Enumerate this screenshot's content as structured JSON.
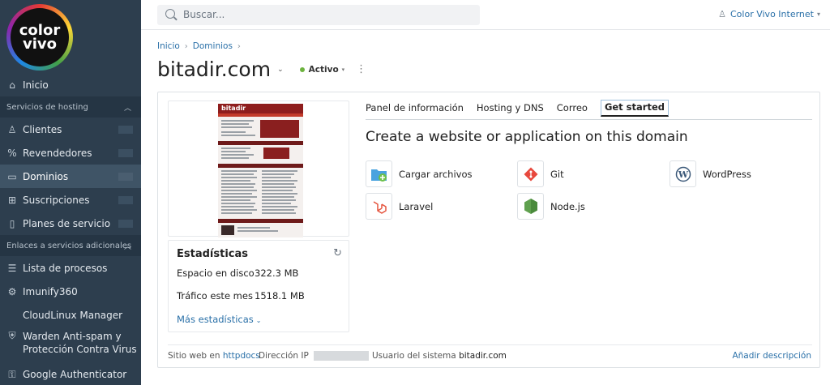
{
  "brand": {
    "logo_line1": "color",
    "logo_line2": "vivo"
  },
  "sidebar": {
    "home": "Inicio",
    "section_hosting": "Servicios de hosting",
    "hosting_items": [
      {
        "label": "Clientes",
        "icon": "user-icon"
      },
      {
        "label": "Revendedores",
        "icon": "percent-icon"
      },
      {
        "label": "Dominios",
        "icon": "monitor-icon"
      },
      {
        "label": "Suscripciones",
        "icon": "grid-icon"
      },
      {
        "label": "Planes de servicio",
        "icon": "book-icon"
      }
    ],
    "section_extra": "Enlaces a servicios adicionales",
    "extra_items": [
      {
        "label": "Lista de procesos",
        "icon": "list-icon"
      },
      {
        "label": "Imunify360",
        "icon": "gear-icon"
      },
      {
        "label": "CloudLinux Manager",
        "icon": "cloud-icon"
      },
      {
        "label": "Warden Anti-spam y",
        "label2": "Protección Contra Virus",
        "icon": "shield-icon"
      },
      {
        "label": "Google Authenticator",
        "icon": "key-icon"
      }
    ]
  },
  "header": {
    "search_placeholder": "Buscar...",
    "user": "Color Vivo Internet"
  },
  "breadcrumb": {
    "item1": "Inicio",
    "item2": "Dominios"
  },
  "page": {
    "title": "bitadir.com",
    "status": "Activo"
  },
  "preview": {
    "site_logo_text": "bitadir"
  },
  "stats": {
    "title": "Estadísticas",
    "disk_label": "Espacio en disco",
    "disk_value": "322.3 MB",
    "traffic_label": "Tráfico este mes",
    "traffic_value": "1518.1 MB",
    "more": "Más estadísticas"
  },
  "tabs": [
    "Panel de información",
    "Hosting y DNS",
    "Correo",
    "Get started"
  ],
  "get_started": {
    "title": "Create a website or application on this domain",
    "tools": [
      "Cargar archivos",
      "Git",
      "WordPress",
      "Laravel",
      "Node.js"
    ]
  },
  "footer": {
    "site_label": "Sitio web en",
    "site_link": "httpdocs",
    "ip_label": "Dirección IP",
    "sys_user_label": "Usuario del sistema",
    "sys_user": "bitadir.com",
    "add_desc": "Añadir descripción"
  },
  "colors": {
    "sidebar": "#2d3e4e",
    "link": "#2a70a8",
    "status_active": "#6db33f"
  }
}
